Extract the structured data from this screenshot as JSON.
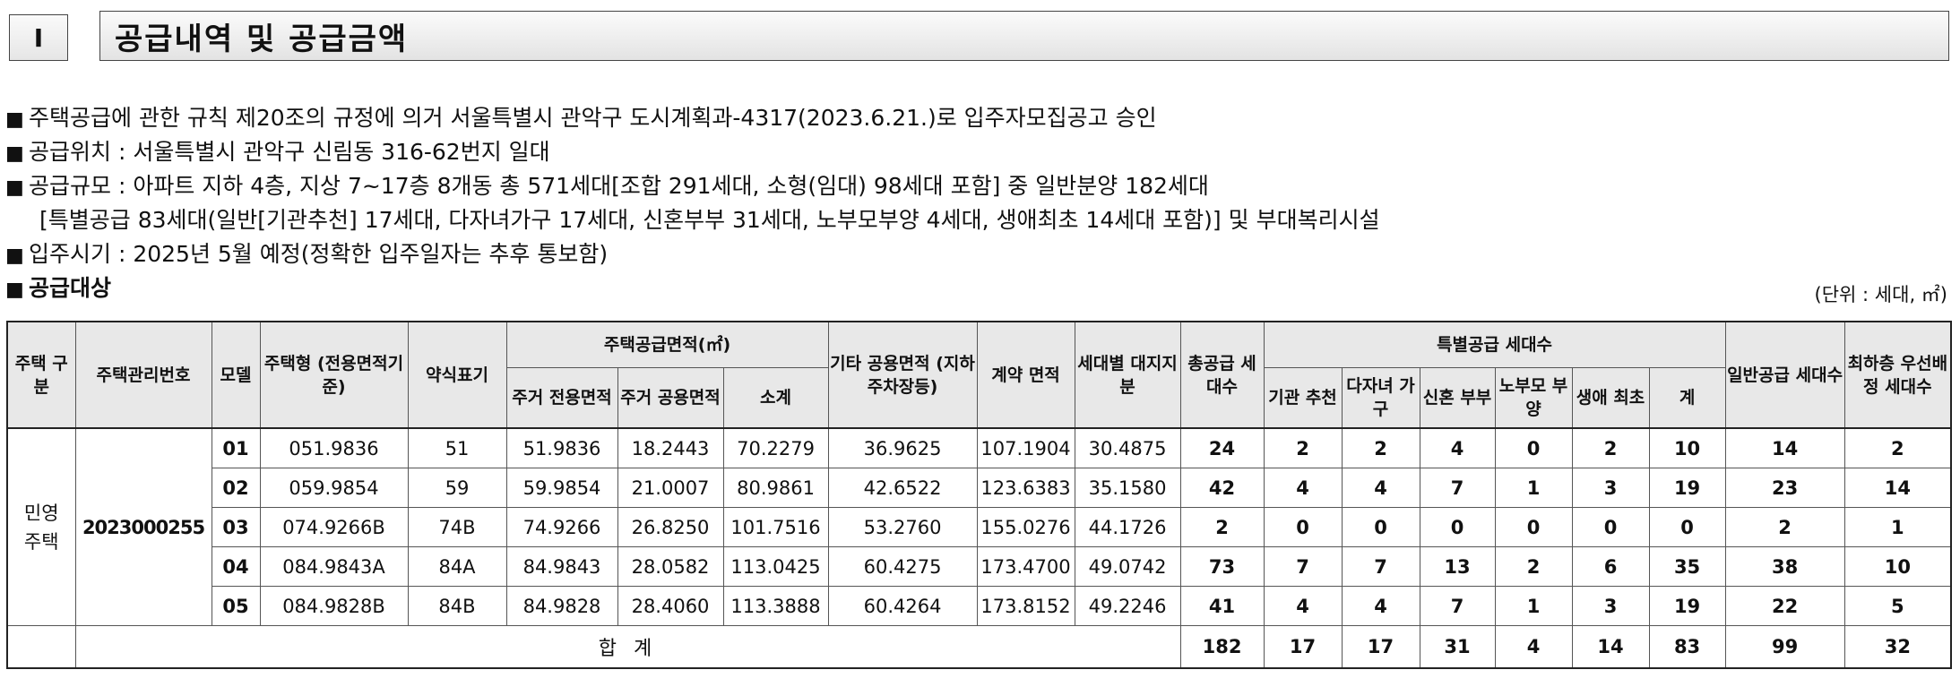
{
  "section": {
    "number": "I",
    "title": "공급내역 및 공급금액"
  },
  "bullets": {
    "marker": "■",
    "line1": "주택공급에 관한 규칙 제20조의 규정에 의거 서울특별시 관악구 도시계획과-4317(2023.6.21.)로 입주자모집공고 승인",
    "line2": "공급위치 : 서울특별시 관악구 신림동 316-62번지 일대",
    "line3": "공급규모 : 아파트 지하 4층, 지상 7~17층 8개동 총 571세대[조합 291세대, 소형(임대) 98세대 포함] 중 일반분양 182세대",
    "line3b": "[특별공급 83세대(일반[기관추천] 17세대, 다자녀가구 17세대, 신혼부부 31세대, 노부모부양 4세대, 생애최초 14세대 포함)] 및 부대복리시설",
    "line4": "입주시기 : 2025년 5월 예정(정확한 입주일자는 추후 통보함)",
    "line5": "공급대상"
  },
  "unit": "(단위 : 세대, ㎡)",
  "table": {
    "headers": {
      "type": "주택 구분",
      "mgmt_no": "주택관리번호",
      "model": "모델",
      "house_type": "주택형 (전용면적기준)",
      "abbr": "약식표기",
      "supply_area": "주택공급면적(㎡)",
      "res_excl": "주거 전용면적",
      "res_common": "주거 공용면적",
      "subtotal": "소계",
      "other_common": "기타 공용면적 (지하주차장등)",
      "contract_area": "계약 면적",
      "land_share": "세대별 대지지분",
      "total_units": "총공급 세대수",
      "special": "특별공급 세대수",
      "sp_inst": "기관 추천",
      "sp_multi": "다자녀 가구",
      "sp_newly": "신혼 부부",
      "sp_elder": "노부모 부양",
      "sp_first": "생애 최초",
      "sp_sum": "계",
      "general": "일반공급 세대수",
      "lowest": "최하층 우선배정 세대수"
    },
    "group_type": "민영 주택",
    "mgmt_no": "2023000255",
    "rows": [
      {
        "model": "01",
        "type": "051.9836",
        "abbr": "51",
        "excl": "51.9836",
        "common": "18.2443",
        "sub": "70.2279",
        "other": "36.9625",
        "contract": "107.1904",
        "land": "30.4875",
        "total": "24",
        "inst": "2",
        "multi": "2",
        "newly": "4",
        "elder": "0",
        "first": "2",
        "sum": "10",
        "general": "14",
        "lowest": "2"
      },
      {
        "model": "02",
        "type": "059.9854",
        "abbr": "59",
        "excl": "59.9854",
        "common": "21.0007",
        "sub": "80.9861",
        "other": "42.6522",
        "contract": "123.6383",
        "land": "35.1580",
        "total": "42",
        "inst": "4",
        "multi": "4",
        "newly": "7",
        "elder": "1",
        "first": "3",
        "sum": "19",
        "general": "23",
        "lowest": "14"
      },
      {
        "model": "03",
        "type": "074.9266B",
        "abbr": "74B",
        "excl": "74.9266",
        "common": "26.8250",
        "sub": "101.7516",
        "other": "53.2760",
        "contract": "155.0276",
        "land": "44.1726",
        "total": "2",
        "inst": "0",
        "multi": "0",
        "newly": "0",
        "elder": "0",
        "first": "0",
        "sum": "0",
        "general": "2",
        "lowest": "1"
      },
      {
        "model": "04",
        "type": "084.9843A",
        "abbr": "84A",
        "excl": "84.9843",
        "common": "28.0582",
        "sub": "113.0425",
        "other": "60.4275",
        "contract": "173.4700",
        "land": "49.0742",
        "total": "73",
        "inst": "7",
        "multi": "7",
        "newly": "13",
        "elder": "2",
        "first": "6",
        "sum": "35",
        "general": "38",
        "lowest": "10"
      },
      {
        "model": "05",
        "type": "084.9828B",
        "abbr": "84B",
        "excl": "84.9828",
        "common": "28.4060",
        "sub": "113.3888",
        "other": "60.4264",
        "contract": "173.8152",
        "land": "49.2246",
        "total": "41",
        "inst": "4",
        "multi": "4",
        "newly": "7",
        "elder": "1",
        "first": "3",
        "sum": "19",
        "general": "22",
        "lowest": "5"
      }
    ],
    "total": {
      "label": "합 계",
      "total": "182",
      "inst": "17",
      "multi": "17",
      "newly": "31",
      "elder": "4",
      "first": "14",
      "sum": "83",
      "general": "99",
      "lowest": "32"
    }
  }
}
